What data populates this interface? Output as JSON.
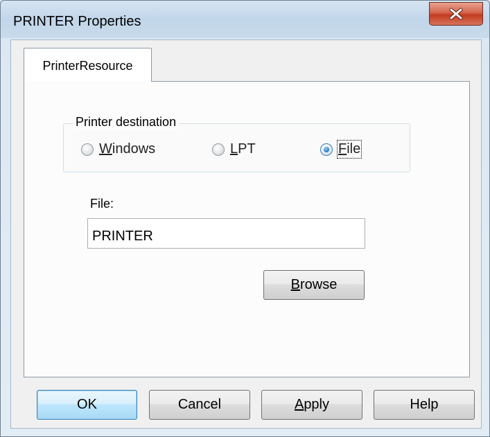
{
  "window": {
    "title": "PRINTER Properties"
  },
  "tabs": [
    {
      "label": "PrinterResource",
      "selected": true
    }
  ],
  "destination_group": {
    "label": "Printer destination",
    "options": [
      {
        "label": "Windows",
        "accel": "W",
        "rest": "indows",
        "selected": false
      },
      {
        "label": "LPT",
        "accel": "L",
        "rest": "PT",
        "selected": false
      },
      {
        "label": "File",
        "accel": "F",
        "rest": "ile",
        "selected": true
      }
    ]
  },
  "file_field": {
    "label": "File:",
    "value": "PRINTER"
  },
  "buttons": {
    "browse": {
      "accel": "B",
      "rest": "rowse"
    },
    "ok": "OK",
    "cancel": "Cancel",
    "apply": {
      "accel": "A",
      "rest": "pply"
    },
    "help": "Help"
  },
  "icons": {
    "close": "close-icon"
  },
  "colors": {
    "close_button": "#c33b1f",
    "radio_selected": "#2d82c9",
    "default_button_border": "#3c7fb1"
  }
}
